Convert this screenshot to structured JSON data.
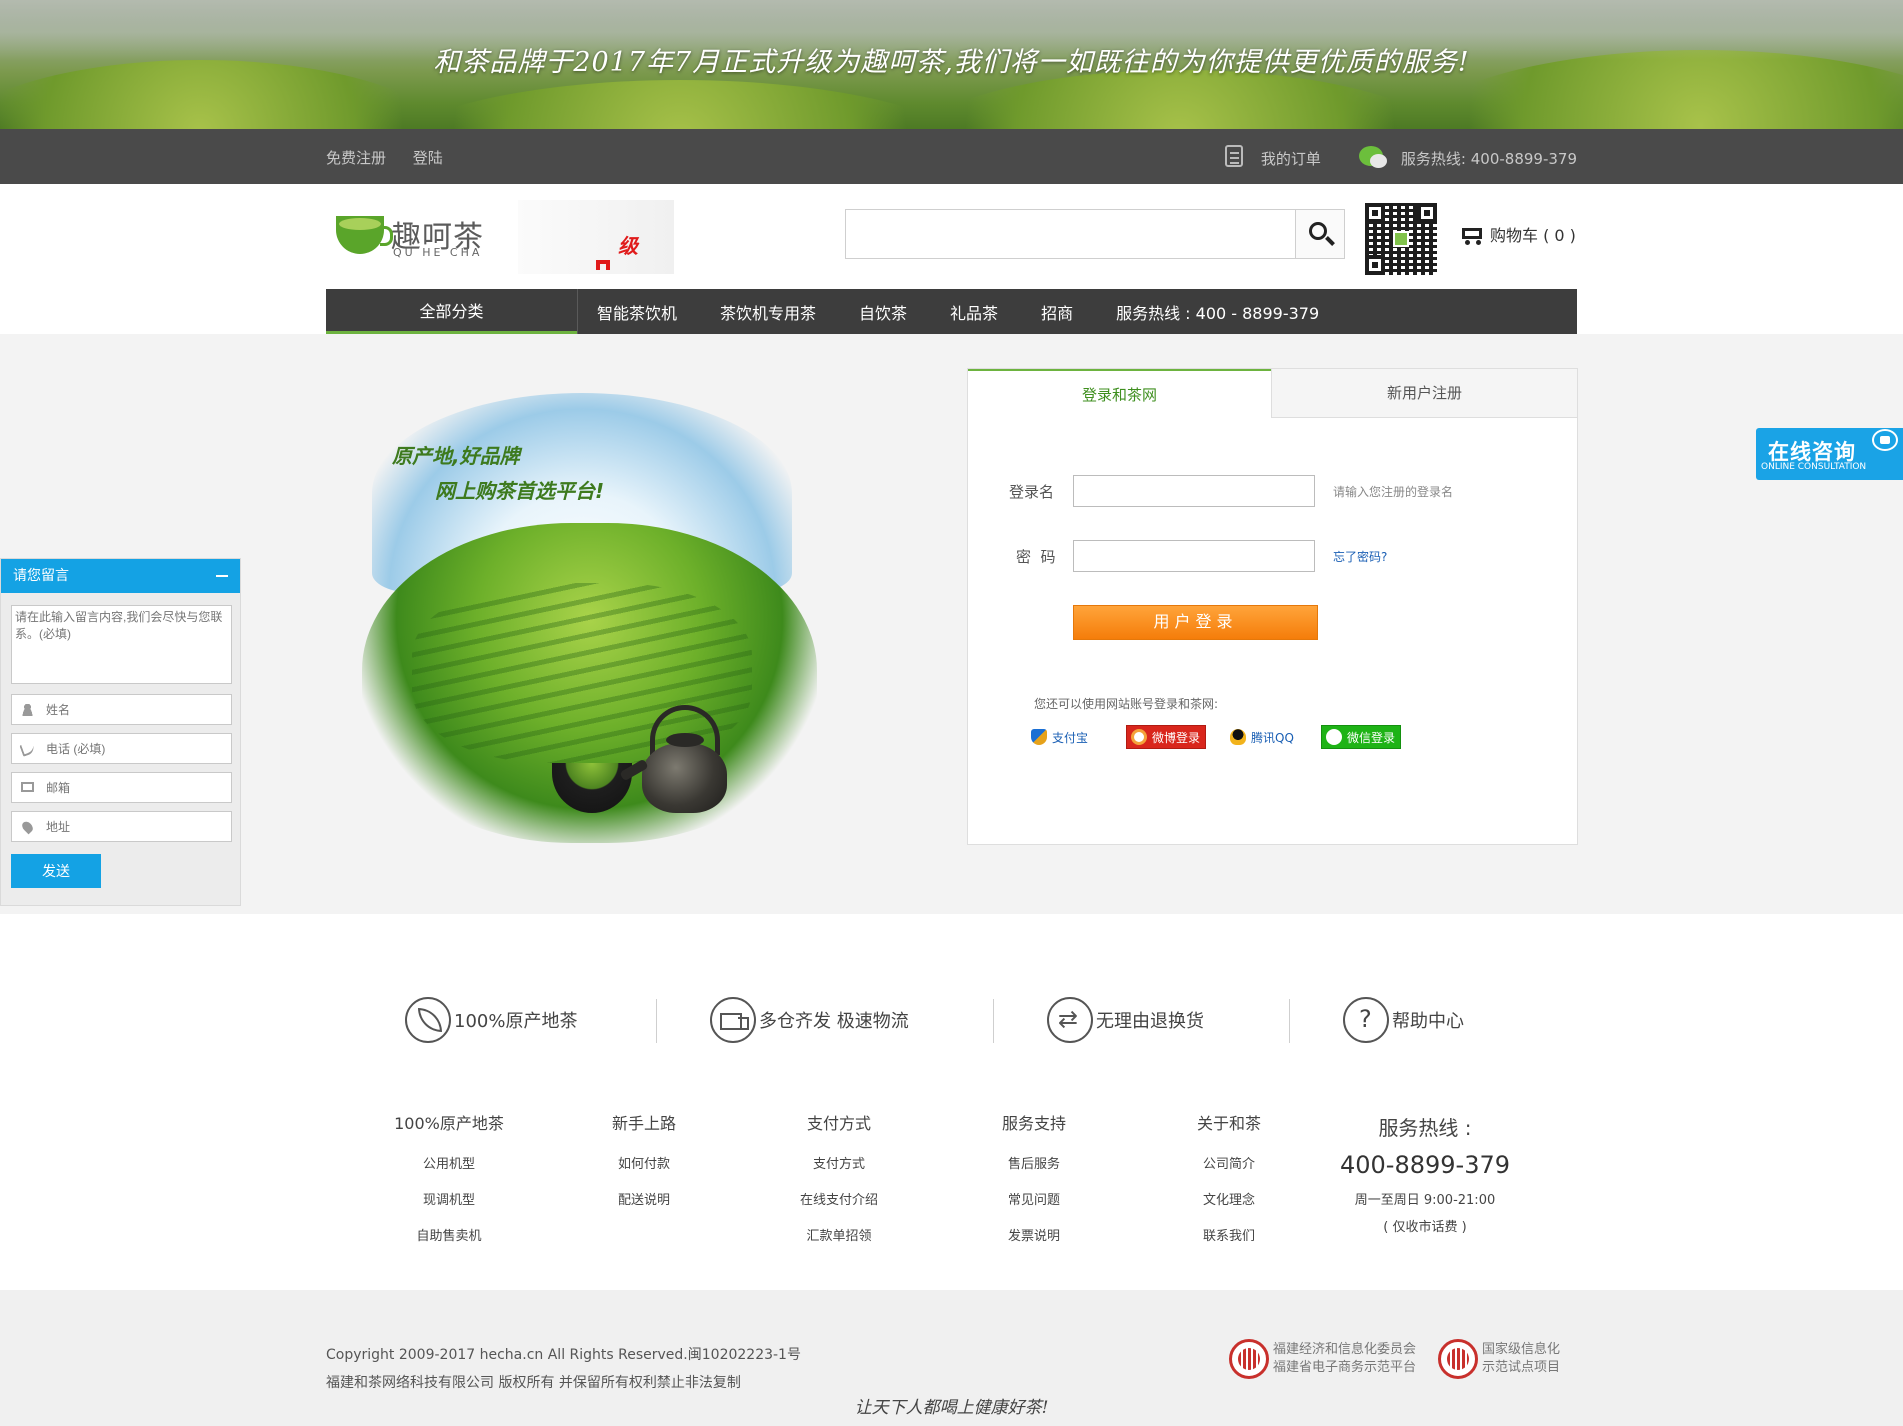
{
  "banner": {
    "text": "和茶品牌于2017年7月正式升级为趣呵茶,我们将一如既往的为你提供更优质的服务!"
  },
  "topbar": {
    "register": "免费注册",
    "login": "登陆",
    "my_orders": "我的订单",
    "hotline": "服务热线: 400-8899-379"
  },
  "header": {
    "logo_text": "趣呵茶",
    "logo_pinyin": "QU HE CHA",
    "upgrade_text": "级",
    "search_placeholder": "",
    "cart": "购物车 ( 0 )"
  },
  "nav": {
    "all": "全部分类",
    "items": [
      "智能茶饮机",
      "茶饮机专用茶",
      "自饮茶",
      "礼品茶",
      "招商"
    ],
    "hotline": "服务热线 : 400 - 8899-379"
  },
  "promo": {
    "line1": "原产地,好品牌",
    "line2": "网上购茶首选平台!"
  },
  "login": {
    "tab_login": "登录和茶网",
    "tab_register": "新用户注册",
    "username_label": "登录名",
    "username_hint": "请输入您注册的登录名",
    "password_label": "密  码",
    "forgot": "忘了密码?",
    "button": "用户登录",
    "third_tip": "您还可以使用网站账号登录和茶网:",
    "alipay": "支付宝",
    "weibo": "微博登录",
    "qq": "腾讯QQ",
    "wechat": "微信登录"
  },
  "message": {
    "title": "请您留言",
    "content_placeholder": "请在此输入留言内容,我们会尽快与您联系。(必填)",
    "name_placeholder": "姓名",
    "phone_placeholder": "电话 (必填)",
    "email_placeholder": "邮箱",
    "address_placeholder": "地址",
    "send": "发送"
  },
  "consult": {
    "title": "在线咨询",
    "subtitle": "ONLINE CONSULTATION"
  },
  "features": [
    "100%原产地茶",
    "多仓齐发 极速物流",
    "无理由退换货",
    "帮助中心"
  ],
  "footer_columns": [
    {
      "title": "100%原产地茶",
      "links": [
        "公用机型",
        "现调机型",
        "自助售卖机"
      ]
    },
    {
      "title": "新手上路",
      "links": [
        "如何付款",
        "配送说明"
      ]
    },
    {
      "title": "支付方式",
      "links": [
        "支付方式",
        "在线支付介绍",
        "汇款单招领"
      ]
    },
    {
      "title": "服务支持",
      "links": [
        "售后服务",
        "常见问题",
        "发票说明"
      ]
    },
    {
      "title": "关于和茶",
      "links": [
        "公司简介",
        "文化理念",
        "联系我们"
      ]
    }
  ],
  "hotline": {
    "title": "服务热线 :",
    "number": "400-8899-379",
    "hours": "周一至周日 9:00-21:00",
    "note": "( 仅收市话费 )"
  },
  "bottom": {
    "copyright": "Copyright 2009-2017 hecha.cn All Rights Reserved.闽10202223-1号",
    "company": "福建和茶网络科技有限公司 版权所有 并保留所有权利禁止非法复制",
    "badge1_line1": "福建经济和信息化委员会",
    "badge1_line2": "福建省电子商务示范平台",
    "badge2_line1": "国家级信息化",
    "badge2_line2": "示范试点项目",
    "motto": "让天下人都喝上健康好茶!"
  },
  "colors": {
    "accent_green": "#6db33f",
    "widget_blue": "#14a2e4",
    "login_orange": "#f57d0a",
    "nav_dark": "#3d3d3d"
  }
}
